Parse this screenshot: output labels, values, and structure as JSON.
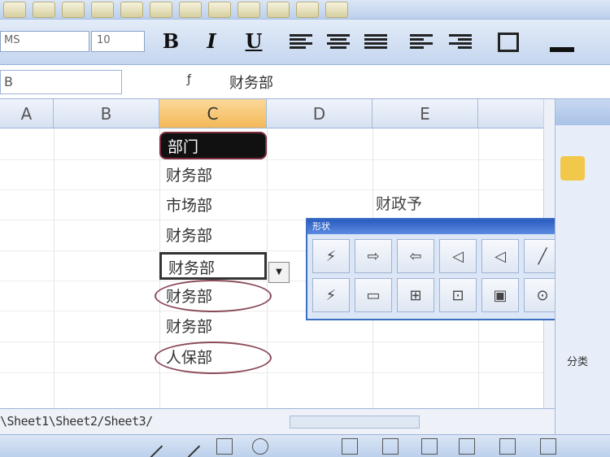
{
  "toolbar": {
    "font_name": "MS",
    "font_size": "10",
    "bold": "B",
    "italic": "I",
    "underline": "U"
  },
  "formula_bar": {
    "name_box": "B",
    "fx": "ƒ",
    "content": "财务部"
  },
  "grid": {
    "columns": [
      "A",
      "B",
      "C",
      "D",
      "E"
    ],
    "active_column": "C",
    "column_c_cells": [
      "部门",
      "财务部",
      "市场部",
      "财务部",
      "财务部",
      "财务部",
      "财务部",
      "人保部"
    ],
    "e_cell": "财政予"
  },
  "drawing_toolbar": {
    "title": "形状",
    "close": "×"
  },
  "task_pane": {
    "label": "分类"
  },
  "sheet_tabs": {
    "text": "\\Sheet1\\Sheet2/Sheet3/"
  }
}
